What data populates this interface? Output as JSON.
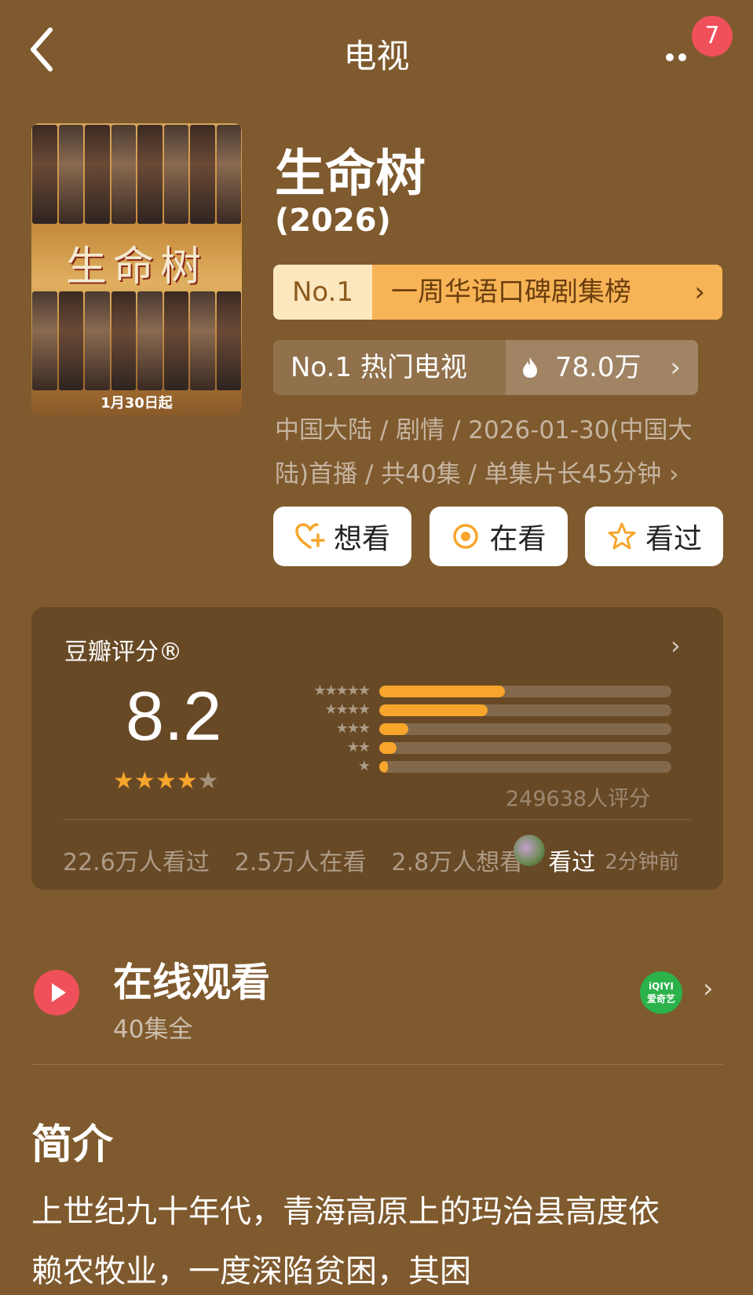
{
  "topbar": {
    "title": "电视",
    "badge_count": "7"
  },
  "show": {
    "title": "生命树",
    "year": "(2026)",
    "poster_title": "生命树",
    "poster_date": "1月30日起"
  },
  "rank": {
    "no": "No.1",
    "text": "一周华语口碑剧集榜",
    "chevron": "›"
  },
  "hot": {
    "label": "No.1 热门电视",
    "icon": "flame-icon",
    "count": "78.0万",
    "chevron": "›"
  },
  "meta": {
    "line": "中国大陆 / 剧情 / 2026-01-30(中国大陆)首播 / 共40集 / 单集片长45分钟 ›"
  },
  "actions": [
    {
      "label": "想看",
      "icon": "heart-plus-icon"
    },
    {
      "label": "在看",
      "icon": "target-icon"
    },
    {
      "label": "看过",
      "icon": "star-outline-icon"
    }
  ],
  "rating": {
    "title": "豆瓣评分®",
    "score": "8.2",
    "stars_filled": 4,
    "stars_total": 5,
    "distribution": [
      {
        "stars": "★★★★★",
        "percent": 43
      },
      {
        "stars": "★★★★",
        "percent": 37
      },
      {
        "stars": "★★★",
        "percent": 10
      },
      {
        "stars": "★★",
        "percent": 6
      },
      {
        "stars": "★",
        "percent": 3
      }
    ],
    "count": "249638人评分",
    "watched": "22.6万人看过",
    "watching": "2.5万人在看",
    "want": "2.8万人想看",
    "latest_action": "看过",
    "latest_time": "2分钟前",
    "accent_color": "#f7a52b"
  },
  "watch": {
    "title": "在线观看",
    "subtitle": "40集全",
    "platform": "iQIYI 爱奇艺",
    "chevron": "›"
  },
  "intro": {
    "title": "简介",
    "text": "上世纪九十年代，青海高原上的玛治县高度依赖农牧业，一度深陷贫困，其困"
  }
}
